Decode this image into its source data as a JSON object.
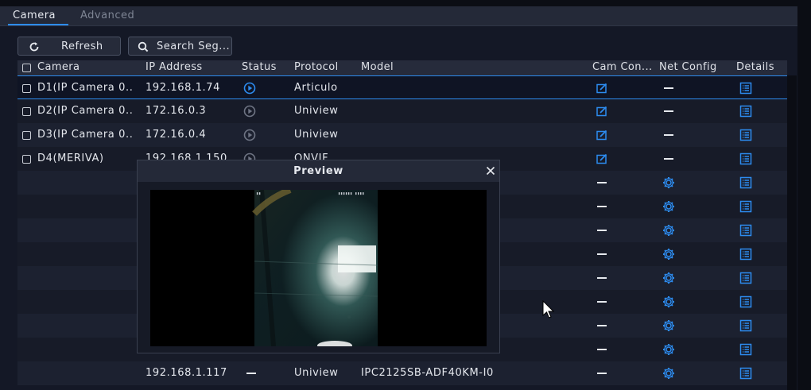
{
  "tabs": [
    {
      "label": "Camera",
      "active": true
    },
    {
      "label": "Advanced",
      "active": false
    }
  ],
  "toolbar": {
    "refresh_label": "Refresh",
    "search_label": "Search Seg..."
  },
  "table": {
    "columns": [
      "Camera",
      "IP Address",
      "Status",
      "Protocol",
      "Model",
      "Cam Con...",
      "Net Config",
      "Details"
    ],
    "rows": [
      {
        "camera": "D1(IP Camera 0..",
        "ip": "192.168.1.74",
        "status": "online",
        "protocol": "Articulo",
        "model": "",
        "cam_config": "edit",
        "net_config": "dash",
        "details": "list",
        "selected": true,
        "checkbox": true
      },
      {
        "camera": "D2(IP Camera 0..",
        "ip": "172.16.0.3",
        "status": "offline",
        "protocol": "Uniview",
        "model": "",
        "cam_config": "edit",
        "net_config": "dash",
        "details": "list",
        "selected": false,
        "checkbox": true
      },
      {
        "camera": "D3(IP Camera 0..",
        "ip": "172.16.0.4",
        "status": "offline",
        "protocol": "Uniview",
        "model": "",
        "cam_config": "edit",
        "net_config": "dash",
        "details": "list",
        "selected": false,
        "checkbox": true
      },
      {
        "camera": "D4(MERIVA)",
        "ip": "192.168.1.150",
        "status": "offline",
        "protocol": "ONVIF",
        "model": "",
        "cam_config": "edit",
        "net_config": "dash",
        "details": "list",
        "selected": false,
        "checkbox": true
      },
      {
        "camera": "",
        "ip": "",
        "status": "",
        "protocol": "",
        "model": "",
        "cam_config": "dash",
        "net_config": "gear",
        "details": "list",
        "selected": false,
        "checkbox": false
      },
      {
        "camera": "",
        "ip": "",
        "status": "",
        "protocol": "",
        "model": "",
        "cam_config": "dash",
        "net_config": "gear",
        "details": "list",
        "selected": false,
        "checkbox": false
      },
      {
        "camera": "",
        "ip": "",
        "status": "",
        "protocol": "",
        "model": "",
        "cam_config": "dash",
        "net_config": "gear",
        "details": "list",
        "selected": false,
        "checkbox": false
      },
      {
        "camera": "",
        "ip": "",
        "status": "",
        "protocol": "",
        "model": "",
        "cam_config": "dash",
        "net_config": "gear",
        "details": "list",
        "selected": false,
        "checkbox": false
      },
      {
        "camera": "",
        "ip": "",
        "status": "",
        "protocol": "",
        "model": "",
        "cam_config": "dash",
        "net_config": "gear",
        "details": "list",
        "selected": false,
        "checkbox": false
      },
      {
        "camera": "",
        "ip": "",
        "status": "",
        "protocol": "",
        "model": "",
        "cam_config": "dash",
        "net_config": "gear",
        "details": "list",
        "selected": false,
        "checkbox": false
      },
      {
        "camera": "",
        "ip": "",
        "status": "",
        "protocol": "",
        "model": "",
        "cam_config": "dash",
        "net_config": "gear",
        "details": "list",
        "selected": false,
        "checkbox": false
      },
      {
        "camera": "",
        "ip": "",
        "status": "",
        "protocol": "",
        "model": "",
        "cam_config": "dash",
        "net_config": "gear",
        "details": "list",
        "selected": false,
        "checkbox": false
      },
      {
        "camera": "",
        "ip": "192.168.1.117",
        "status": "dash",
        "protocol": "Uniview",
        "model": "IPC2125SB-ADF40KM-I0",
        "cam_config": "dash",
        "net_config": "gear",
        "details": "list",
        "selected": false,
        "checkbox": false
      }
    ]
  },
  "preview": {
    "title": "Preview"
  },
  "colors": {
    "accent": "#2d8cf0",
    "background": "#141826",
    "row_odd": "#1c2130",
    "row_even": "#171b28"
  },
  "icons": {
    "refresh": "refresh-icon",
    "search": "search-icon",
    "online": "play-circle-icon",
    "offline": "play-circle-icon",
    "edit": "edit-icon",
    "gear": "gear-icon",
    "list": "list-icon",
    "close": "close-icon",
    "cursor": "mouse-pointer-icon"
  }
}
